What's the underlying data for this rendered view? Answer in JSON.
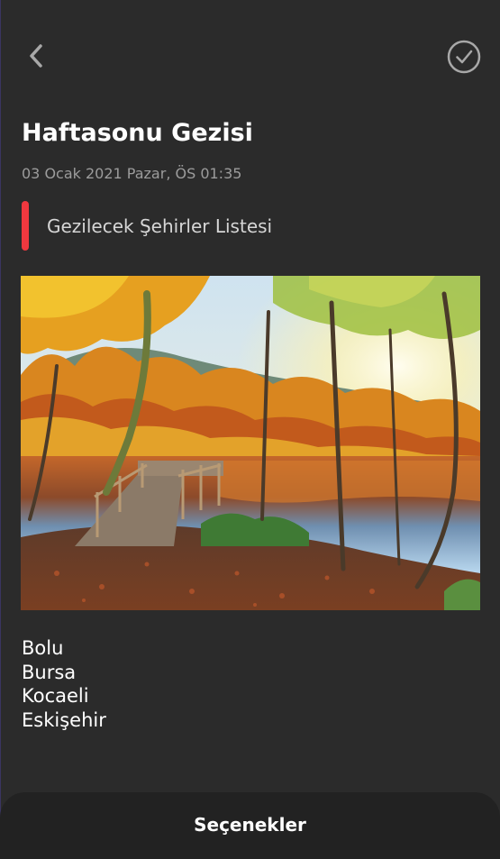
{
  "header": {
    "back_icon": "chevron-left-icon",
    "done_icon": "check-circle-icon"
  },
  "note": {
    "title": "Haftasonu Gezisi",
    "date": "03 Ocak 2021 Pazar, ÖS 01:35",
    "category_label": "Gezilecek Şehirler Listesi",
    "category_color": "#f0383f",
    "image_description": "autumn-lake-landscape",
    "items": [
      "Bolu",
      "Bursa",
      "Kocaeli",
      "Eskişehir"
    ]
  },
  "bottom_sheet": {
    "label": "Seçenekler"
  },
  "colors": {
    "background": "#2b2b2b",
    "sheet": "#222222",
    "muted_text": "#9c9c9c"
  }
}
